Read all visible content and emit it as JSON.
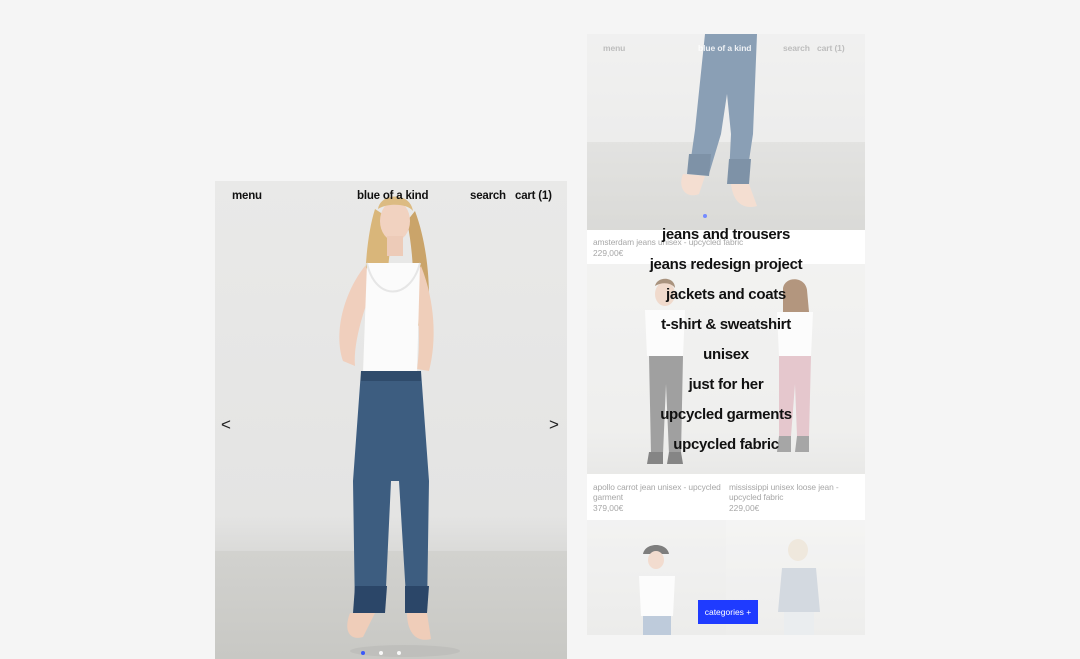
{
  "left_screen": {
    "header": {
      "menu": "menu",
      "brand": "blue of a kind",
      "search": "search",
      "cart": "cart (1)"
    },
    "carousel": {
      "prev": "<",
      "next": ">",
      "slides": 3,
      "active_slide": 1
    },
    "colors": {
      "accent": "#2b4dff",
      "background": "#e6e6e5"
    }
  },
  "right_screen": {
    "header": {
      "menu": "menu",
      "brand": "blue of a kind",
      "search": "search",
      "cart": "cart (1)"
    },
    "products": [
      {
        "name": "amsterdam jeans unisex - upcycled fabric",
        "price": "229,00€"
      },
      {
        "name": "apollo carrot jean unisex - upcycled garment",
        "price": "379,00€"
      },
      {
        "name": "mississippi unisex loose jean - upcycled fabric",
        "price": "229,00€"
      }
    ],
    "categories_menu": [
      "jeans and trousers",
      "jeans redesign project",
      "jackets and coats",
      "t-shirt & sweatshirt",
      "unisex",
      "just for her",
      "upcycled garments",
      "upcycled fabric"
    ],
    "categories_button": "categories +",
    "colors": {
      "button": "#1f3bff"
    }
  }
}
